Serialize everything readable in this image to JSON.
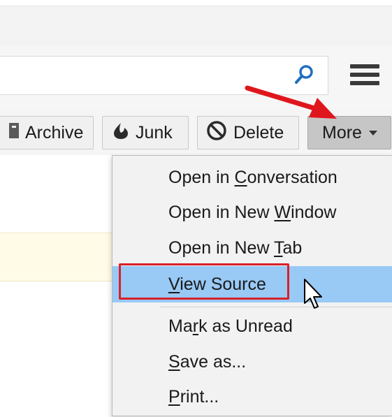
{
  "toolbar": {
    "archive_label": "Archive",
    "junk_label": "Junk",
    "delete_label": "Delete",
    "more_label": "More"
  },
  "menu": {
    "items": [
      {
        "pre": "Open in ",
        "key": "C",
        "post": "onversation"
      },
      {
        "pre": "Open in New ",
        "key": "W",
        "post": "indow"
      },
      {
        "pre": "Open in New ",
        "key": "T",
        "post": "ab"
      },
      {
        "pre": "",
        "key": "V",
        "post": "iew Source"
      },
      {
        "pre": "Ma",
        "key": "r",
        "post": "k as Unread"
      },
      {
        "pre": "",
        "key": "S",
        "post": "ave as..."
      },
      {
        "pre": "",
        "key": "P",
        "post": "rint..."
      }
    ],
    "selected_index": 3
  },
  "annotations": {
    "highlight_color": "#d8202a",
    "arrow_color": "#e0161d",
    "selection_color": "#99c9f5"
  },
  "icons": {
    "search": "search-icon",
    "menu": "hamburger-menu-icon",
    "archive": "archive-icon",
    "junk": "junk-flame-icon",
    "delete": "delete-prohibited-icon",
    "dropdown": "chevron-down-icon",
    "cursor": "mouse-pointer-icon",
    "arrow": "red-arrow-icon"
  }
}
